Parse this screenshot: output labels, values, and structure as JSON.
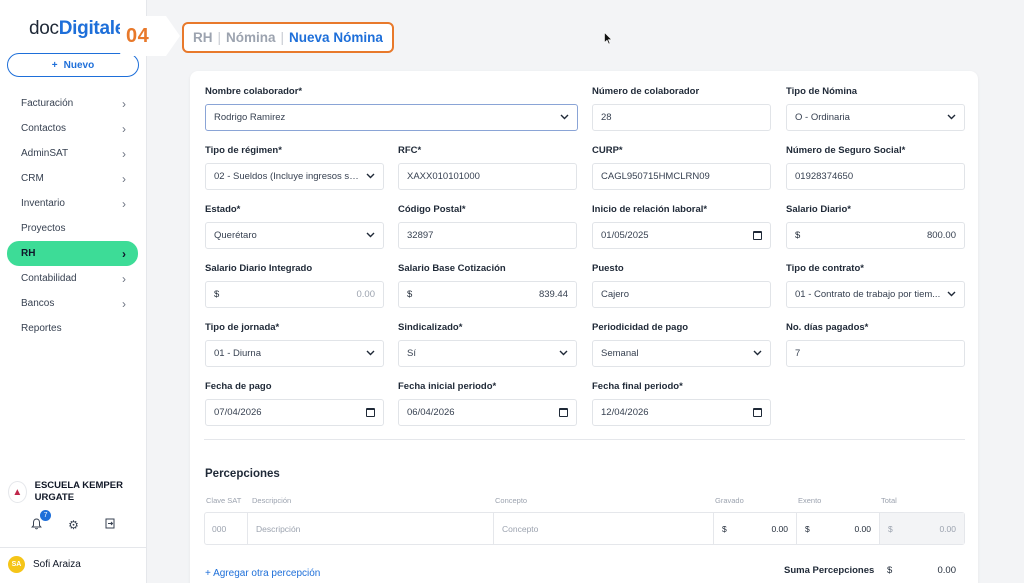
{
  "brand": {
    "logo_part1": "doc",
    "logo_part2": "Digitales",
    "accent": "#1e6fd9"
  },
  "sidebar": {
    "new_button": "Nuevo",
    "items": [
      {
        "label": "Facturación",
        "chevron": true
      },
      {
        "label": "Contactos",
        "chevron": true
      },
      {
        "label": "AdminSAT",
        "chevron": true
      },
      {
        "label": "CRM",
        "chevron": true
      },
      {
        "label": "Inventario",
        "chevron": true
      },
      {
        "label": "Proyectos",
        "chevron": false
      },
      {
        "label": "RH",
        "chevron": true,
        "active": true
      },
      {
        "label": "Contabilidad",
        "chevron": true
      },
      {
        "label": "Bancos",
        "chevron": true
      },
      {
        "label": "Reportes",
        "chevron": false
      }
    ],
    "org_name": "ESCUELA KEMPER URGATE",
    "notifications": "7",
    "user_initials": "SA",
    "user_name": "Sofi Araiza"
  },
  "step": "04",
  "breadcrumb": {
    "crumb1": "RH",
    "crumb2": "Nómina",
    "current": "Nueva Nómina",
    "separator": "|"
  },
  "form": {
    "nombre_colaborador": {
      "label": "Nombre colaborador*",
      "value": "Rodrigo Ramirez"
    },
    "numero_colaborador": {
      "label": "Número de colaborador",
      "value": "28"
    },
    "tipo_nomina": {
      "label": "Tipo de Nómina",
      "value": "O - Ordinaria"
    },
    "tipo_regimen": {
      "label": "Tipo de régimen*",
      "value": "02 - Sueldos (Incluye ingresos se..."
    },
    "rfc": {
      "label": "RFC*",
      "value": "XAXX010101000"
    },
    "curp": {
      "label": "CURP*",
      "value": "CAGL950715HMCLRN09"
    },
    "nss": {
      "label": "Número de Seguro Social*",
      "value": "01928374650"
    },
    "estado": {
      "label": "Estado*",
      "value": "Querétaro"
    },
    "codigo_postal": {
      "label": "Código Postal*",
      "value": "32897"
    },
    "inicio_relacion": {
      "label": "Inicio de relación laboral*",
      "value": "01/05/2025"
    },
    "salario_diario": {
      "label": "Salario Diario*",
      "currency": "$",
      "value": "800.00"
    },
    "sdi": {
      "label": "Salario Diario Integrado",
      "currency": "$",
      "value": "0.00"
    },
    "sbc": {
      "label": "Salario Base Cotización",
      "currency": "$",
      "value": "839.44"
    },
    "puesto": {
      "label": "Puesto",
      "value": "Cajero"
    },
    "tipo_contrato": {
      "label": "Tipo de contrato*",
      "value": "01 - Contrato de trabajo por tiem..."
    },
    "tipo_jornada": {
      "label": "Tipo de jornada*",
      "value": "01 - Diurna"
    },
    "sindicalizado": {
      "label": "Sindicalizado*",
      "value": "Sí"
    },
    "periodicidad": {
      "label": "Periodicidad de pago",
      "value": "Semanal"
    },
    "dias_pagados": {
      "label": "No. días pagados*",
      "value": "7"
    },
    "fecha_pago": {
      "label": "Fecha de pago",
      "value": "07/04/2026"
    },
    "fecha_inicial": {
      "label": "Fecha inicial periodo*",
      "value": "06/04/2026"
    },
    "fecha_final": {
      "label": "Fecha final periodo*",
      "value": "12/04/2026"
    }
  },
  "percepciones": {
    "title": "Percepciones",
    "headers": [
      "Clave SAT",
      "Descripción",
      "Concepto",
      "Gravado",
      "Exento",
      "Total"
    ],
    "row": {
      "clave": "000",
      "descripcion": "Descripción",
      "concepto": "Concepto",
      "gravado_cur": "$",
      "gravado": "0.00",
      "exento_cur": "$",
      "exento": "0.00",
      "total_cur": "$",
      "total": "0.00"
    },
    "add_link": "+ Agregar otra percepción",
    "sum_label": "Suma Percepciones",
    "sum_currency": "$",
    "sum_value": "0.00"
  }
}
